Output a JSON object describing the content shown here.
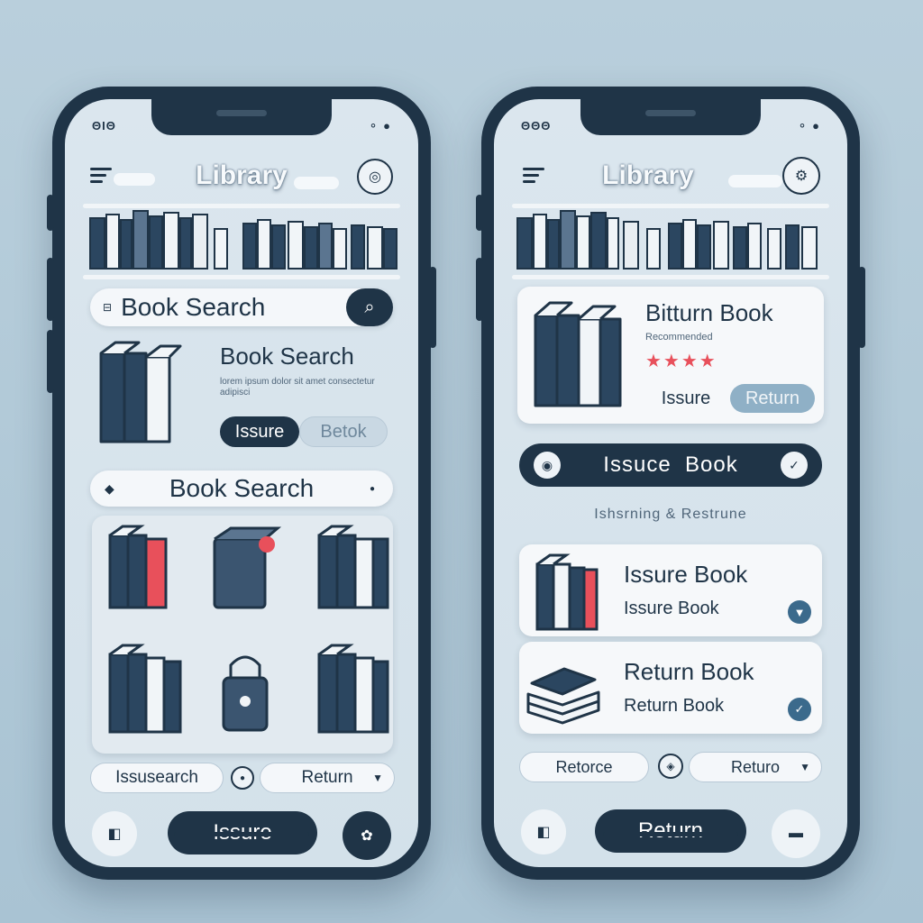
{
  "left": {
    "status_left": "ΘΙΘ",
    "app_title": "Library",
    "search_label": "Book Search",
    "featured_title": "Book Search",
    "featured_desc": "lorem ipsum dolor sit amet consectetur adipisci",
    "issue_btn": "Issure",
    "return_btn": "Betok",
    "second_search": "Book Search",
    "action_left": "Issusearch",
    "action_right": "Return",
    "bottom_main": "Issure"
  },
  "right": {
    "status_left": "ΘΘΘ",
    "app_title": "Library",
    "card_title": "Bitturn Book",
    "card_sub": "Recommended",
    "rating": "★★★★",
    "issue_btn": "Issure",
    "return_btn": "Return",
    "banner_label": "Issuce  Book",
    "section_label": "Ishsrning & Restrune",
    "item1_title": "Issure Book",
    "item1_sub": "Issure Book",
    "item2_title": "Return Book",
    "item2_sub": "Return Book",
    "action_left": "Retorce",
    "action_right": "Returo",
    "bottom_main": "Return"
  },
  "colors": {
    "primary": "#1f3447",
    "accent": "#3b6a8c",
    "highlight": "#e8505b",
    "background": "#dbe6ee"
  },
  "icons": [
    "menu-icon",
    "search-icon",
    "book-icon",
    "bookmark-icon",
    "lock-icon",
    "check-icon",
    "settings-icon"
  ]
}
